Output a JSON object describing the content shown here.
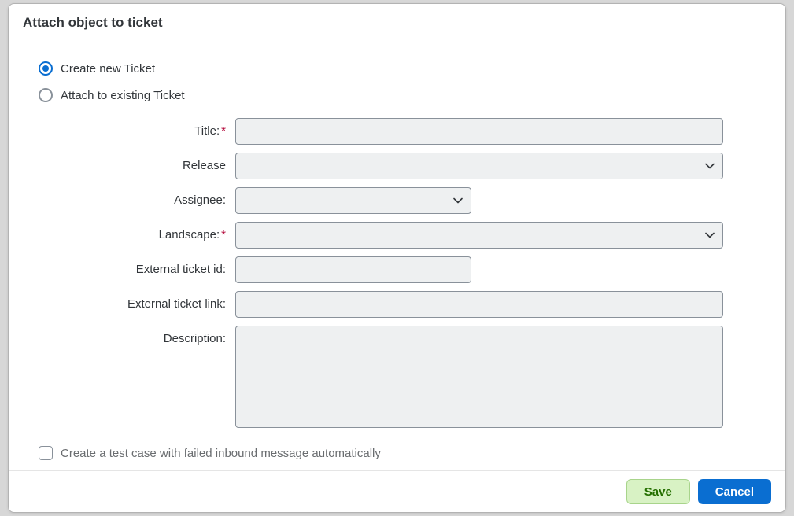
{
  "dialog": {
    "title": "Attach object to ticket"
  },
  "radios": {
    "create_new": "Create new Ticket",
    "attach_existing": "Attach to existing Ticket"
  },
  "form": {
    "title_label": "Title:",
    "title_value": "",
    "release_label": "Release",
    "release_value": "",
    "assignee_label": "Assignee:",
    "assignee_value": "",
    "landscape_label": "Landscape:",
    "landscape_value": "",
    "external_id_label": "External ticket id:",
    "external_id_value": "",
    "external_link_label": "External ticket link:",
    "external_link_value": "",
    "description_label": "Description:",
    "description_value": ""
  },
  "checkbox": {
    "auto_testcase_label": "Create a test case with failed inbound message automatically",
    "auto_testcase_checked": false
  },
  "footer": {
    "save_label": "Save",
    "cancel_label": "Cancel"
  },
  "required_marker": "*"
}
